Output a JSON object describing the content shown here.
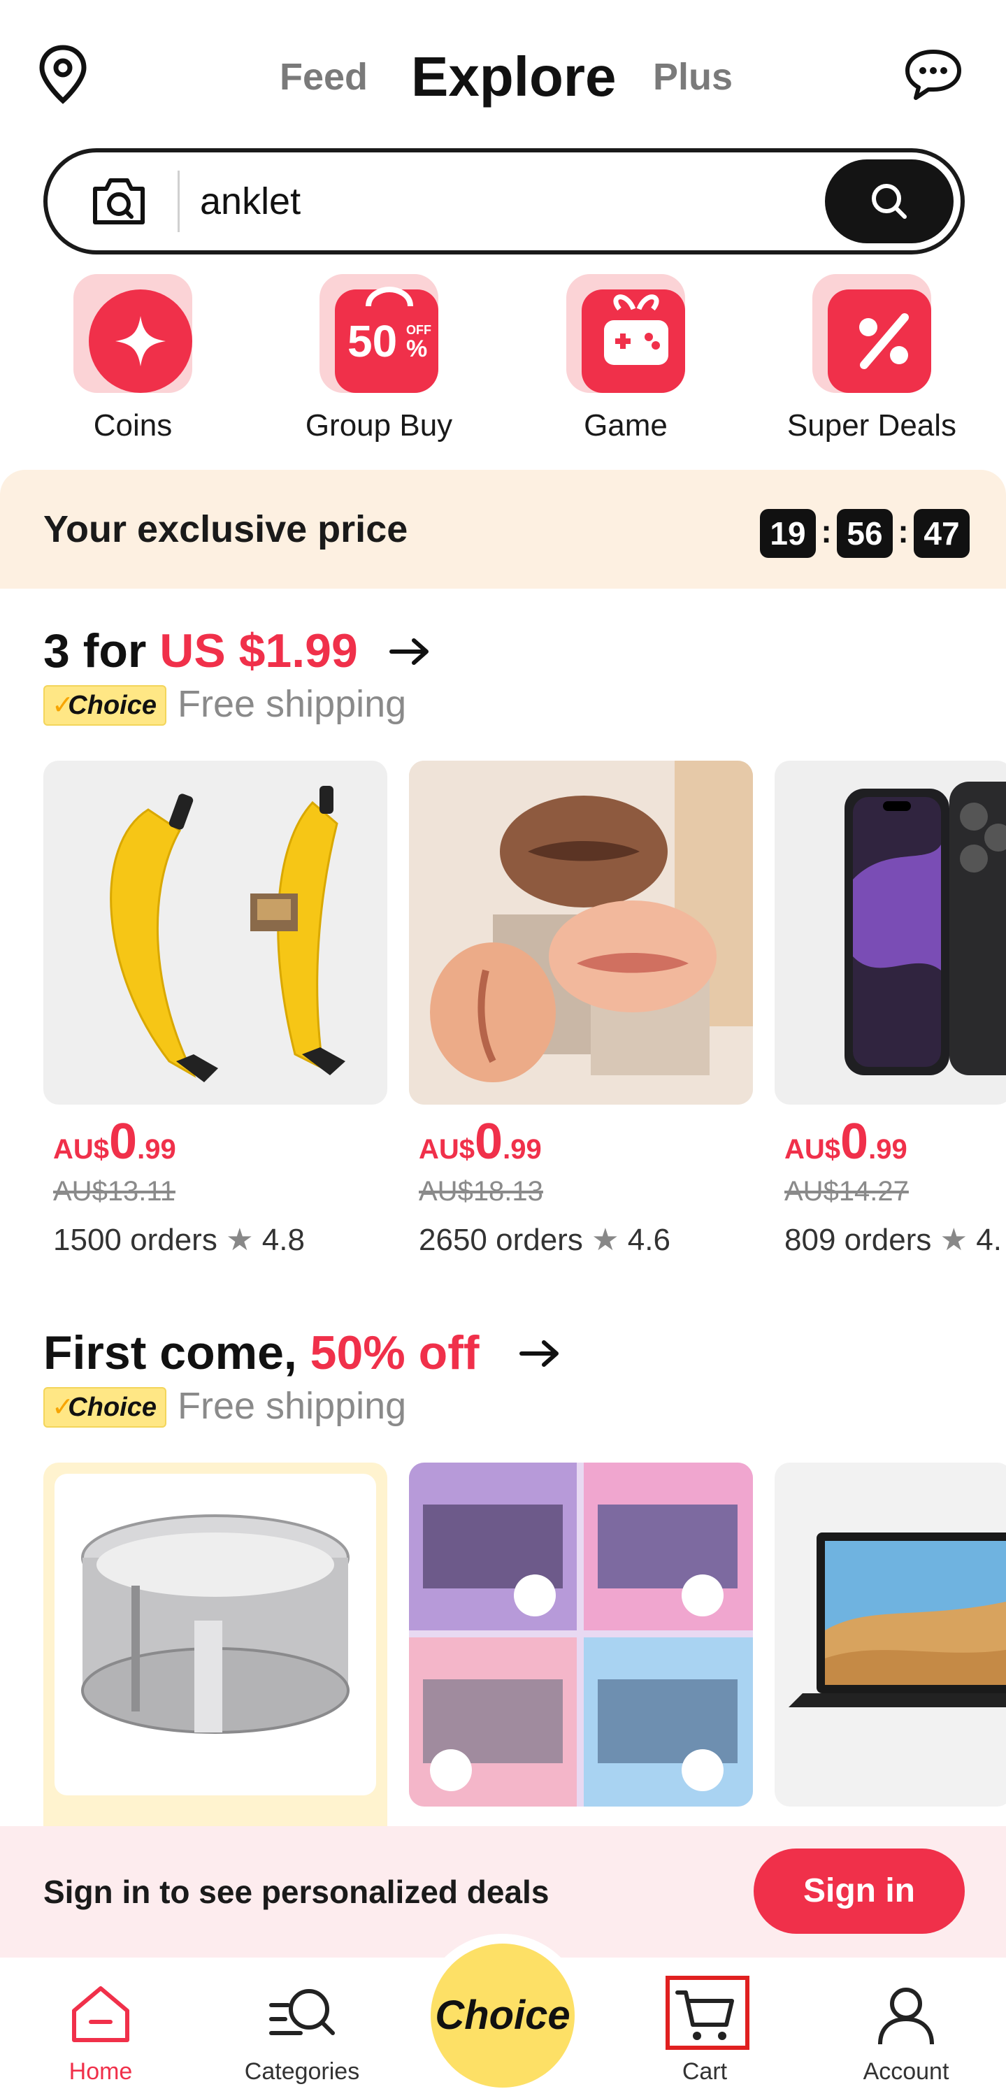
{
  "header": {
    "tabs": [
      "Feed",
      "Explore",
      "Plus"
    ],
    "active_tab": "Explore"
  },
  "search": {
    "value": "anklet"
  },
  "quick_links": [
    {
      "label": "Coins",
      "icon": "star-coin-icon"
    },
    {
      "label": "Group Buy",
      "icon": "fifty-percent-off-bag-icon"
    },
    {
      "label": "Game",
      "icon": "gift-gamepad-icon"
    },
    {
      "label": "Super Deals",
      "icon": "percent-tag-icon"
    }
  ],
  "exclusive": {
    "title": "Your exclusive price",
    "timer": {
      "hours": "19",
      "minutes": "56",
      "seconds": "47"
    }
  },
  "section1": {
    "title_prefix": "3 for ",
    "title_highlight": "US $1.99",
    "badge": "Choice",
    "shipping": "Free shipping",
    "products": [
      {
        "image": "banana-usb-drive",
        "currency": "AU$",
        "price_int": "0",
        "price_dec": ".99",
        "old_price": "AU$13.11",
        "orders": "1500 orders",
        "rating": "4.8"
      },
      {
        "image": "silicone-lips-models",
        "currency": "AU$",
        "price_int": "0",
        "price_dec": ".99",
        "old_price": "AU$18.13",
        "orders": "2650 orders",
        "rating": "4.6"
      },
      {
        "image": "phone-case",
        "currency": "AU$",
        "price_int": "0",
        "price_dec": ".99",
        "old_price": "AU$14.27",
        "orders": "809 orders",
        "rating": "4."
      }
    ]
  },
  "section2": {
    "title_prefix": "First come, ",
    "title_highlight": "50% off",
    "badge": "Choice",
    "shipping": "Free shipping",
    "products": [
      {
        "image": "steel-cake-ring"
      },
      {
        "image": "character-gel-pens"
      },
      {
        "image": "laptop"
      }
    ]
  },
  "signin": {
    "text": "Sign in to see personalized deals",
    "button": "Sign in"
  },
  "bottom_nav": {
    "items": [
      "Home",
      "Categories",
      "Choice",
      "Cart",
      "Account"
    ],
    "active": "Home"
  },
  "colors": {
    "accent": "#f0304a",
    "choice_yellow": "#fde066",
    "banner_bg": "#fdf0e1"
  }
}
